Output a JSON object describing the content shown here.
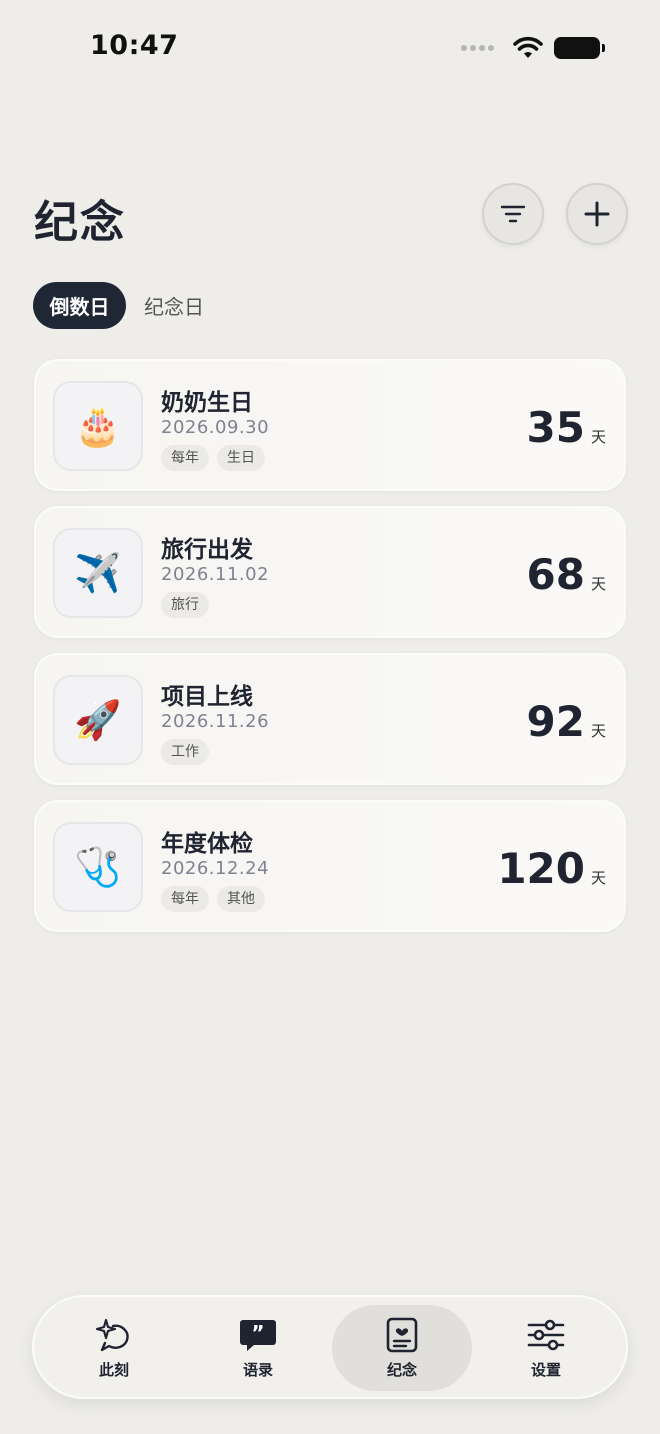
{
  "status": {
    "time": "10:47"
  },
  "header": {
    "title": "纪念",
    "filter_icon": "filter-icon",
    "add_icon": "plus-icon"
  },
  "segments": {
    "active": "倒数日",
    "inactive": "纪念日"
  },
  "events": [
    {
      "title": "奶奶生日",
      "date": "2026.09.30",
      "tags": [
        "每年",
        "生日"
      ],
      "days": "35",
      "unit": "天",
      "icon": "🎂"
    },
    {
      "title": "旅行出发",
      "date": "2026.11.02",
      "tags": [
        "旅行"
      ],
      "days": "68",
      "unit": "天",
      "icon": "✈️"
    },
    {
      "title": "项目上线",
      "date": "2026.11.26",
      "tags": [
        "工作"
      ],
      "days": "92",
      "unit": "天",
      "icon": "🚀"
    },
    {
      "title": "年度体检",
      "date": "2026.12.24",
      "tags": [
        "每年",
        "其他"
      ],
      "days": "120",
      "unit": "天",
      "icon": "🩺"
    }
  ],
  "tabbar": {
    "items": [
      {
        "label": "此刻",
        "icon": "sparkle-moment-icon"
      },
      {
        "label": "语录",
        "icon": "quote-bubble-icon"
      },
      {
        "label": "纪念",
        "icon": "memorial-card-icon"
      },
      {
        "label": "设置",
        "icon": "sliders-icon"
      }
    ],
    "active_index": 2
  },
  "colors": {
    "background": "#eeede9",
    "accent_dark": "#1f2634",
    "card": "#f8f7f4"
  }
}
